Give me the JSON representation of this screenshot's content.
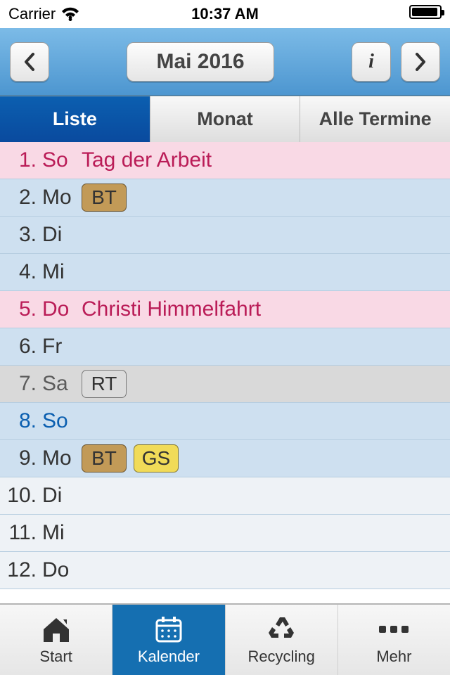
{
  "status": {
    "carrier": "Carrier",
    "time": "10:37 AM"
  },
  "nav": {
    "title": "Mai 2016",
    "info_label": "i"
  },
  "segments": [
    "Liste",
    "Monat",
    "Alle Termine"
  ],
  "active_segment": 0,
  "days": [
    {
      "num": "1.",
      "abbr": "So",
      "kind": "pink",
      "holiday": "Tag der Arbeit",
      "badges": []
    },
    {
      "num": "2.",
      "abbr": "Mo",
      "kind": "blue",
      "holiday": "",
      "badges": [
        {
          "text": "BT",
          "style": "brown"
        }
      ]
    },
    {
      "num": "3.",
      "abbr": "Di",
      "kind": "blue",
      "holiday": "",
      "badges": []
    },
    {
      "num": "4.",
      "abbr": "Mi",
      "kind": "blue",
      "holiday": "",
      "badges": []
    },
    {
      "num": "5.",
      "abbr": "Do",
      "kind": "pink",
      "holiday": "Christi Himmelfahrt",
      "badges": []
    },
    {
      "num": "6.",
      "abbr": "Fr",
      "kind": "blue",
      "holiday": "",
      "badges": []
    },
    {
      "num": "7.",
      "abbr": "Sa",
      "kind": "grey",
      "holiday": "",
      "badges": [
        {
          "text": "RT",
          "style": "grey"
        }
      ]
    },
    {
      "num": "8.",
      "abbr": "So",
      "kind": "blue",
      "holiday": "",
      "badges": [],
      "sunblue": true
    },
    {
      "num": "9.",
      "abbr": "Mo",
      "kind": "blue",
      "holiday": "",
      "badges": [
        {
          "text": "BT",
          "style": "brown"
        },
        {
          "text": "GS",
          "style": "yellow"
        }
      ]
    },
    {
      "num": "10.",
      "abbr": "Di",
      "kind": "white",
      "holiday": "",
      "badges": []
    },
    {
      "num": "11.",
      "abbr": "Mi",
      "kind": "white",
      "holiday": "",
      "badges": []
    },
    {
      "num": "12.",
      "abbr": "Do",
      "kind": "white",
      "holiday": "",
      "badges": []
    }
  ],
  "tabs": [
    {
      "label": "Start",
      "icon": "home"
    },
    {
      "label": "Kalender",
      "icon": "calendar"
    },
    {
      "label": "Recycling",
      "icon": "recycle"
    },
    {
      "label": "Mehr",
      "icon": "more"
    }
  ],
  "active_tab": 1
}
